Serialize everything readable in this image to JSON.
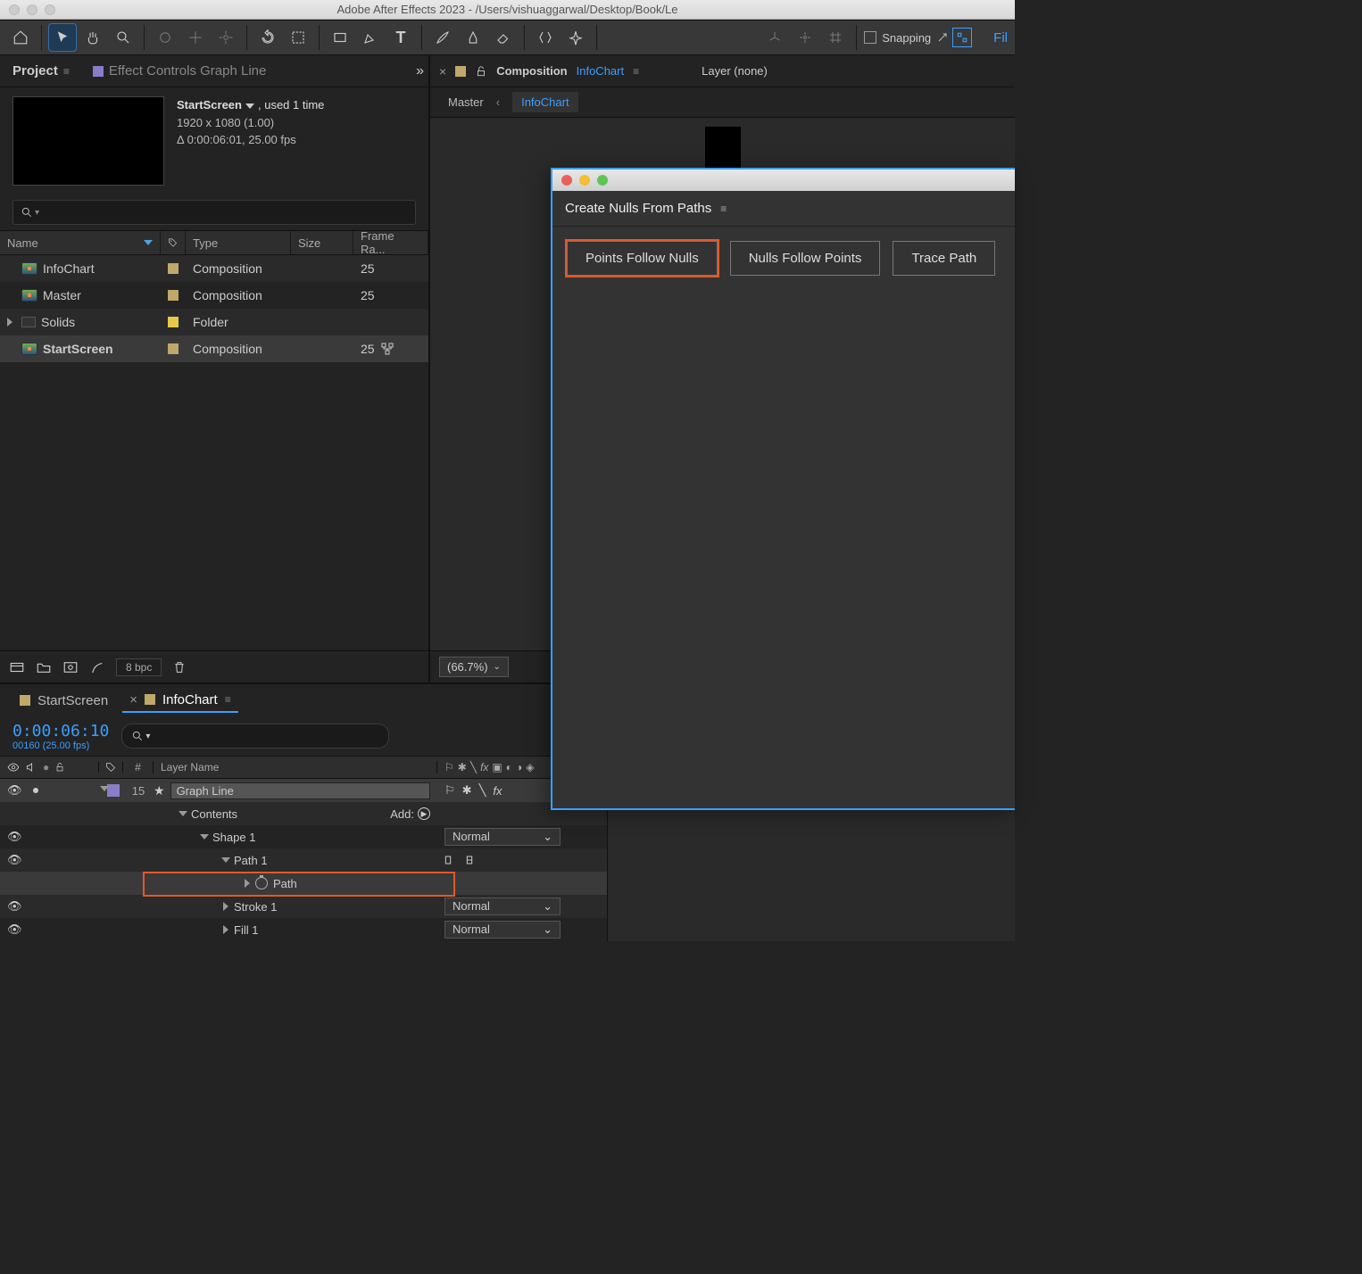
{
  "window_title": "Adobe After Effects 2023 - /Users/vishuaggarwal/Desktop/Book/Le",
  "snapping_label": "Snapping",
  "right_link": "Fil",
  "project_panel": {
    "tab_project": "Project",
    "tab_effect": "Effect Controls Graph Line",
    "comp_name": "StartScreen",
    "comp_used": ", used 1 time",
    "comp_dims": "1920 x 1080 (1.00)",
    "comp_dur": "Δ 0:00:06:01, 25.00 fps",
    "headers": {
      "name": "Name",
      "type": "Type",
      "size": "Size",
      "frame": "Frame Ra..."
    },
    "rows": [
      {
        "name": "InfoChart",
        "type": "Composition",
        "fr": "25",
        "icon": "comp",
        "tag": "tan"
      },
      {
        "name": "Master",
        "type": "Composition",
        "fr": "25",
        "icon": "comp",
        "tag": "tan"
      },
      {
        "name": "Solids",
        "type": "Folder",
        "fr": "",
        "icon": "folder",
        "tag": "yellow",
        "expandable": true
      },
      {
        "name": "StartScreen",
        "type": "Composition",
        "fr": "25",
        "icon": "comp",
        "tag": "tan",
        "selected": true
      }
    ],
    "bpc": "8 bpc"
  },
  "comp_panel": {
    "label": "Composition",
    "name": "InfoChart",
    "layer_label": "Layer",
    "layer_value": "(none)",
    "breadcrumb": [
      "Master",
      "InfoChart"
    ],
    "zoom": "(66.7%)"
  },
  "float_panel": {
    "title": "Create Nulls From Paths",
    "buttons": [
      "Points Follow Nulls",
      "Nulls Follow Points",
      "Trace Path"
    ]
  },
  "timeline": {
    "tabs": [
      {
        "label": "StartScreen",
        "active": false
      },
      {
        "label": "InfoChart",
        "active": true
      }
    ],
    "timecode": "0:00:06:10",
    "timecode_sub": "00160 (25.00 fps)",
    "header_num": "#",
    "header_layer": "Layer Name",
    "layer": {
      "num": "15",
      "name": "Graph Line"
    },
    "contents": "Contents",
    "add": "Add:",
    "shape1": "Shape 1",
    "shape1_mode": "Normal",
    "path1": "Path 1",
    "path": "Path",
    "stroke1": "Stroke 1",
    "stroke1_mode": "Normal",
    "fill1": "Fill 1",
    "fill1_mode": "Normal"
  }
}
